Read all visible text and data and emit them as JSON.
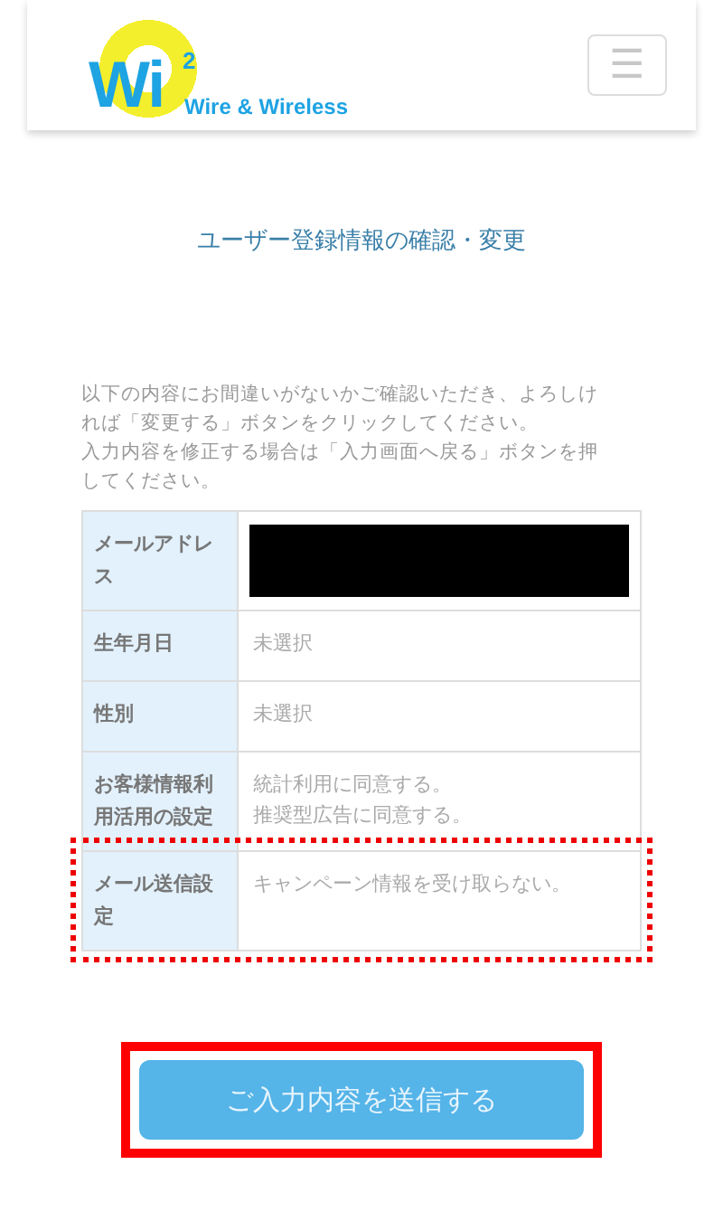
{
  "header": {
    "logo": {
      "mark": "Wi",
      "superscript": "2",
      "tagline": "Wire & Wireless"
    },
    "menu_button": "☰"
  },
  "title": "ユーザー登録情報の確認・変更",
  "instructions": [
    "以下の内容にお間違いがないかご確認いただき、よろしければ「変更する」ボタンをクリックしてください。",
    "入力内容を修正する場合は「入力画面へ戻る」ボタンを押してください。"
  ],
  "rows": [
    {
      "label": "メールアドレス",
      "kind": "redacted",
      "highlighted": false
    },
    {
      "label": "生年月日",
      "kind": "text",
      "values": [
        "未選択"
      ],
      "highlighted": false
    },
    {
      "label": "性別",
      "kind": "text",
      "values": [
        "未選択"
      ],
      "highlighted": false
    },
    {
      "label": "お客様情報利用活用の設定",
      "kind": "text",
      "values": [
        "統計利用に同意する。",
        "推奨型広告に同意する。"
      ],
      "highlighted": false
    },
    {
      "label": "メール送信設定",
      "kind": "text",
      "values": [
        "キャンペーン情報を受け取らない。"
      ],
      "highlighted": true
    }
  ],
  "submit": {
    "label": "ご入力内容を送信する",
    "highlighted": true
  }
}
